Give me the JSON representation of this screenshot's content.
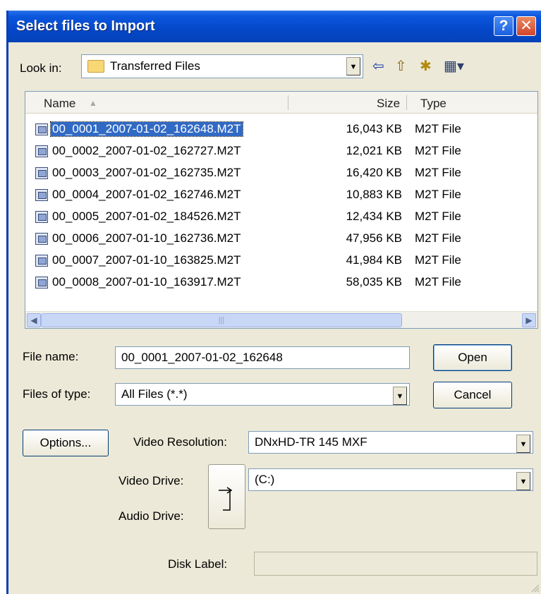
{
  "window": {
    "title": "Select files to Import"
  },
  "titlebar": {
    "help_label": "?",
    "close_label": "✕"
  },
  "lookin": {
    "label": "Look in:",
    "value": "Transferred Files"
  },
  "toolbar": {
    "back_glyph": "⇦",
    "up_glyph": "⇧",
    "new_folder_glyph": "✱",
    "views_glyph": "▦▾"
  },
  "list": {
    "headers": {
      "name": "Name",
      "size": "Size",
      "type": "Type"
    },
    "files": [
      {
        "name": "00_0001_2007-01-02_162648.M2T",
        "size": "16,043 KB",
        "type": "M2T File",
        "selected": true
      },
      {
        "name": "00_0002_2007-01-02_162727.M2T",
        "size": "12,021 KB",
        "type": "M2T File"
      },
      {
        "name": "00_0003_2007-01-02_162735.M2T",
        "size": "16,420 KB",
        "type": "M2T File"
      },
      {
        "name": "00_0004_2007-01-02_162746.M2T",
        "size": "10,883 KB",
        "type": "M2T File"
      },
      {
        "name": "00_0005_2007-01-02_184526.M2T",
        "size": "12,434 KB",
        "type": "M2T File"
      },
      {
        "name": "00_0006_2007-01-10_162736.M2T",
        "size": "47,956 KB",
        "type": "M2T File"
      },
      {
        "name": "00_0007_2007-01-10_163825.M2T",
        "size": "41,984 KB",
        "type": "M2T File"
      },
      {
        "name": "00_0008_2007-01-10_163917.M2T",
        "size": "58,035 KB",
        "type": "M2T File"
      }
    ]
  },
  "filename": {
    "label": "File name:",
    "value": "00_0001_2007-01-02_162648"
  },
  "filetype": {
    "label": "Files of type:",
    "value": "All Files (*.*)"
  },
  "buttons": {
    "open": "Open",
    "cancel": "Cancel",
    "options": "Options..."
  },
  "video_resolution": {
    "label": "Video Resolution:",
    "value": "DNxHD-TR 145  MXF"
  },
  "video_drive": {
    "label": "Video Drive:",
    "value": "(C:)"
  },
  "audio_drive": {
    "label": "Audio Drive:"
  },
  "disk_label": {
    "label": "Disk Label:",
    "value": ""
  }
}
